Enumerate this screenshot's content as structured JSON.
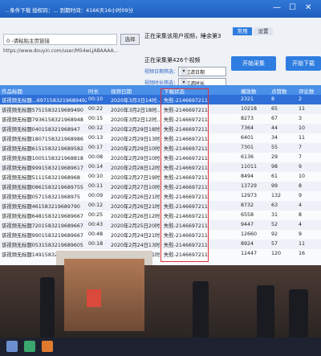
{
  "window": {
    "title": "...条件下载 授权码：... 到期时间：4166天16小时09分",
    "controls": {
      "minimize": "—",
      "maximize": "☐",
      "close": "✕"
    }
  },
  "source_field": {
    "value": "0 -请粘贴主页链接"
  },
  "select_button": {
    "label": "选择"
  },
  "url_text": "https://www.douyin.com/user/MS4wLjABAAAA...",
  "status_line_1": "正在采集该用户视频，睡余第3",
  "status_line_2": "正在采集第426个视频",
  "filters": [
    {
      "label": "视频日期筛选：",
      "value": "不过滤日期"
    },
    {
      "label": "视频时长筛选：",
      "value": "不过滤时长"
    }
  ],
  "tabs": [
    {
      "label": "常用"
    },
    {
      "label": "设置"
    }
  ],
  "buttons": {
    "start_collect": "开始采集",
    "start_download": "开始下载"
  },
  "table": {
    "columns": [
      "作品标题",
      "时长",
      "视频日期",
      "下载状态",
      "播放数",
      "点赞数",
      "评论数"
    ],
    "rows": [
      {
        "title": "该视频无标题...6971583219689492",
        "dur": "00:10",
        "date": "2020年3月3日14时...",
        "status": "失败-2146697211",
        "plays": "2321",
        "likes": "8",
        "comments": "2",
        "selected": true
      },
      {
        "title": "该视频无标题5751583219689490",
        "dur": "00:22",
        "date": "2020年3月2日18时...",
        "status": "失败-2146697211",
        "plays": "10218",
        "likes": "65",
        "comments": "11"
      },
      {
        "title": "该视频无标题7936158321968948",
        "dur": "00:15",
        "date": "2020年3月2日12时...",
        "status": "失败-2146697211",
        "plays": "8273",
        "likes": "67",
        "comments": "3"
      },
      {
        "title": "该视频无标题040158321968947",
        "dur": "00:12",
        "date": "2020年2月29日18时...",
        "status": "失败-2146697211",
        "plays": "7364",
        "likes": "44",
        "comments": "10"
      },
      {
        "title": "该视频无标题1807158321968986",
        "dur": "00:13",
        "date": "2020年2月29日13时...",
        "status": "失败-2146697211",
        "plays": "6401",
        "likes": "34",
        "comments": "11"
      },
      {
        "title": "该视频无标题6151583219689582",
        "dur": "00:17",
        "date": "2020年2月29日10时...",
        "status": "失败-2146697211",
        "plays": "7301",
        "likes": "55",
        "comments": "7"
      },
      {
        "title": "该视频无标题1005158321968818",
        "dur": "00:08",
        "date": "2020年2月29日10时...",
        "status": "失败-2146697211",
        "plays": "6136",
        "likes": "29",
        "comments": "7"
      },
      {
        "title": "该视频无标题9991583219689617",
        "dur": "00:14",
        "date": "2020年2月28日12时...",
        "status": "失败-2146697211",
        "plays": "11011",
        "likes": "98",
        "comments": "9"
      },
      {
        "title": "该视频无标题511158321968968",
        "dur": "00:10",
        "date": "2020年2月27日19时...",
        "status": "失败-2146697211",
        "plays": "8494",
        "likes": "61",
        "comments": "10"
      },
      {
        "title": "该视频无标题0861583219689755",
        "dur": "00:11",
        "date": "2020年2月27日10时...",
        "status": "失败-2146697211",
        "plays": "13729",
        "likes": "99",
        "comments": "8"
      },
      {
        "title": "该视频无标题057158321968975",
        "dur": "00:09",
        "date": "2020年2月26日21时...",
        "status": "失败-2146697211",
        "plays": "12973",
        "likes": "132",
        "comments": "9"
      },
      {
        "title": "该视频无标题461583219689790",
        "dur": "00:12",
        "date": "2020年2月26日21时...",
        "status": "失败-2146697211",
        "plays": "8732",
        "likes": "63",
        "comments": "4"
      },
      {
        "title": "该视频无标题6481583219689667",
        "dur": "00:25",
        "date": "2020年2月26日12时...",
        "status": "失败-2146697211",
        "plays": "6558",
        "likes": "31",
        "comments": "8"
      },
      {
        "title": "该视频无标题7201583219689667",
        "dur": "00:43",
        "date": "2020年2月25日20时...",
        "status": "失败-2146697211",
        "plays": "9447",
        "likes": "52",
        "comments": "4"
      },
      {
        "title": "该视频无标题9901583219689667",
        "dur": "00:48",
        "date": "2020年2月24日21时...",
        "status": "失败-2146697211",
        "plays": "12660",
        "likes": "92",
        "comments": "9"
      },
      {
        "title": "该视频无标题0531583219689605",
        "dur": "00:18",
        "date": "2020年2月24日13时...",
        "status": "失败-2146697211",
        "plays": "8924",
        "likes": "57",
        "comments": "11"
      },
      {
        "title": "该视频无标题1491583219689613",
        "dur": "00:17",
        "date": "2020年2月24日11时...",
        "status": "失败-2146697211",
        "plays": "12447",
        "likes": "120",
        "comments": "16"
      }
    ]
  },
  "colors": {
    "accent": "#2f7de0",
    "header": "#4a8fe8",
    "highlight_box": "#e0323a",
    "selected_row": "#2f6fd8"
  }
}
